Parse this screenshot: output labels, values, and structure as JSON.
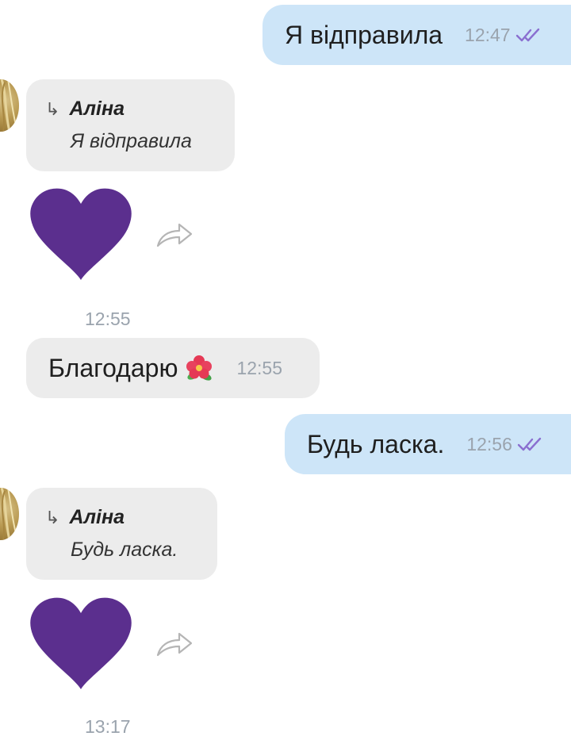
{
  "messages": [
    {
      "type": "outgoing",
      "text": "Я відправила",
      "time": "12:47"
    },
    {
      "type": "incoming-reply",
      "reply_author": "Аліна",
      "reply_text": "Я відправила"
    },
    {
      "type": "sticker",
      "sticker": "purple-heart",
      "time": "12:55"
    },
    {
      "type": "incoming",
      "text": "Благодарю",
      "emoji": "hibiscus",
      "time": "12:55"
    },
    {
      "type": "outgoing",
      "text": "Будь ласка.",
      "time": "12:56"
    },
    {
      "type": "incoming-reply",
      "reply_author": "Аліна",
      "reply_text": "Будь ласка."
    },
    {
      "type": "sticker",
      "sticker": "purple-heart",
      "time": "13:17"
    }
  ],
  "colors": {
    "outgoing_bubble": "#cde5f8",
    "incoming_bubble": "#ececec",
    "heart": "#5b2f8e",
    "read_ticks": "#8a6fd0",
    "time_text": "#9aa3ad"
  },
  "icons": {
    "read_status": "double-check-icon",
    "reply": "reply-arrow-icon",
    "forward": "forward-arrow-icon"
  }
}
